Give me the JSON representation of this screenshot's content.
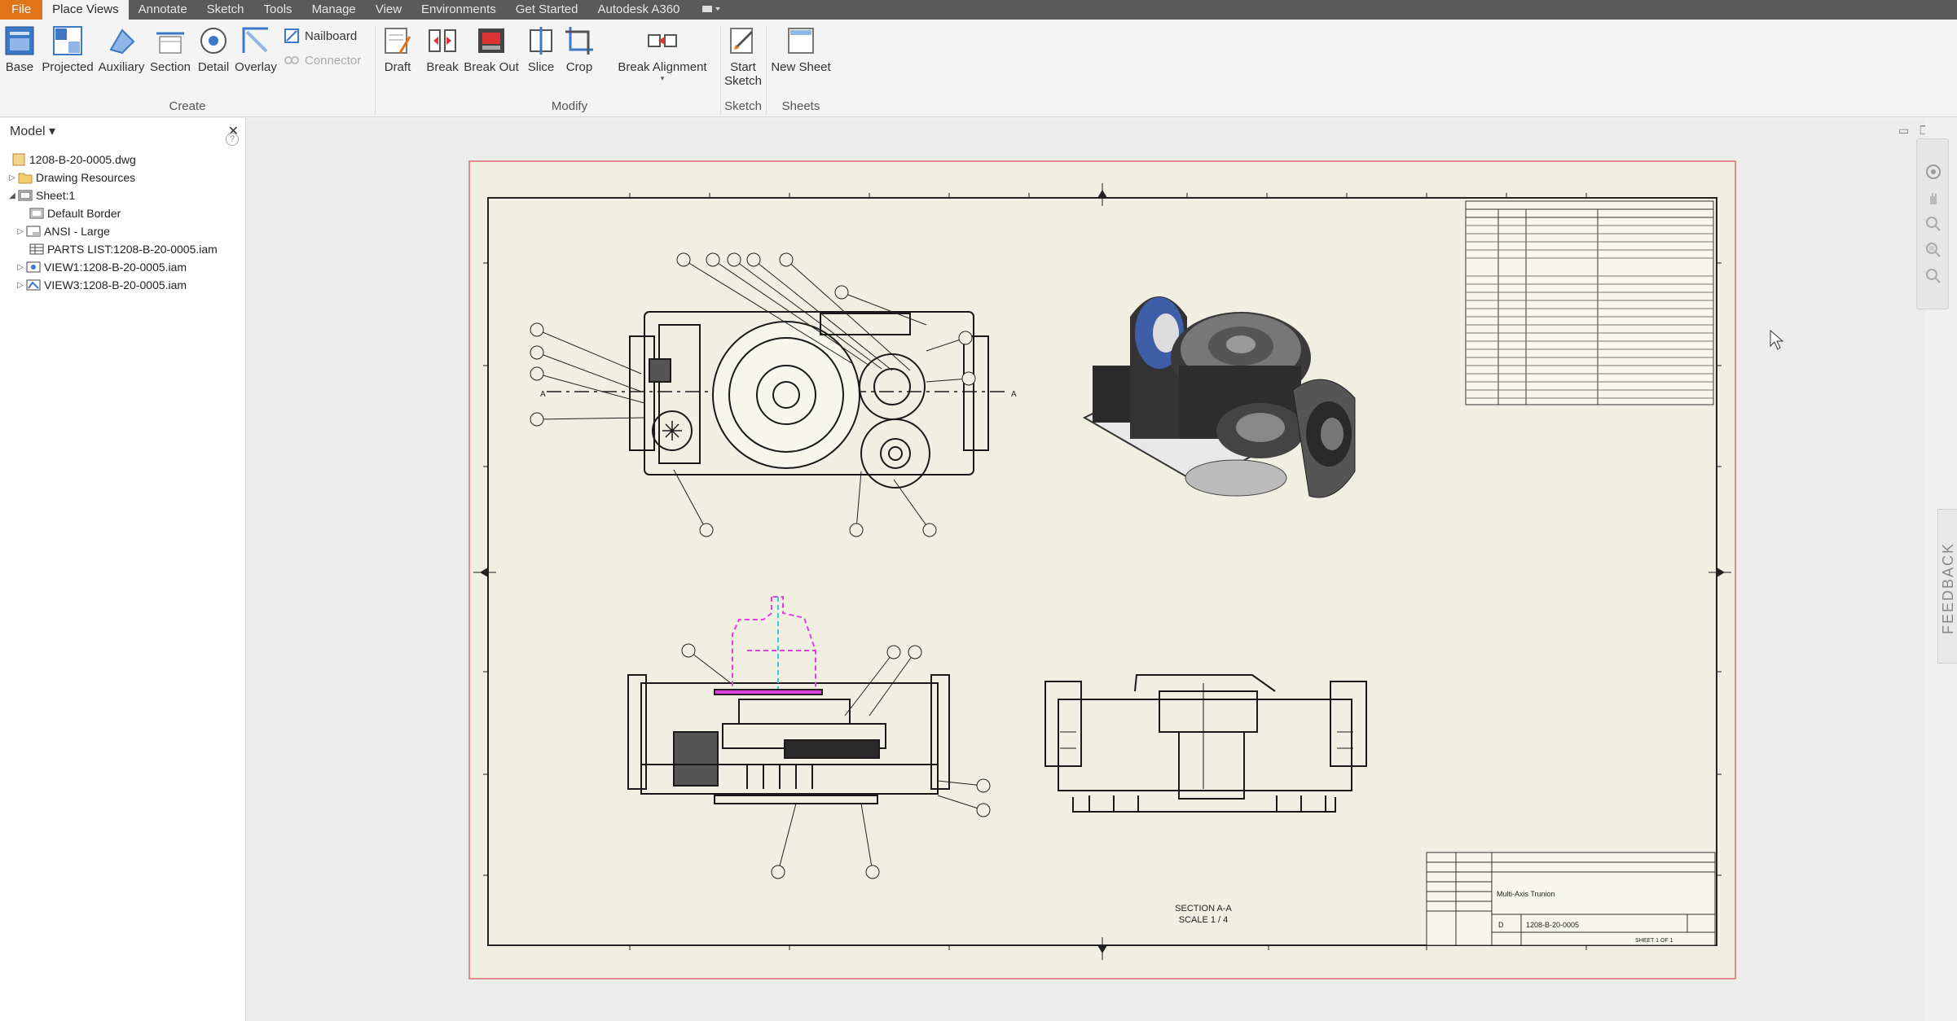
{
  "menu": {
    "file": "File",
    "tabs": [
      "Place Views",
      "Annotate",
      "Sketch",
      "Tools",
      "Manage",
      "View",
      "Environments",
      "Get Started",
      "Autodesk A360"
    ]
  },
  "ribbon": {
    "create": {
      "label": "Create",
      "buttons": [
        "Base",
        "Projected",
        "Auxiliary",
        "Section",
        "Detail",
        "Overlay"
      ],
      "nailboard": "Nailboard",
      "connector": "Connector"
    },
    "modify": {
      "label": "Modify",
      "buttons": [
        "Draft",
        "Break",
        "Break Out",
        "Slice",
        "Crop",
        "Break Alignment"
      ]
    },
    "sketch": {
      "label": "Sketch",
      "button_line1": "Start",
      "button_line2": "Sketch"
    },
    "sheets": {
      "label": "Sheets",
      "button": "New Sheet"
    }
  },
  "browser": {
    "title": "Model ▾",
    "items": [
      "1208-B-20-0005.dwg",
      "Drawing Resources",
      "Sheet:1",
      "Default Border",
      "ANSI - Large",
      "PARTS LIST:1208-B-20-0005.iam",
      "VIEW1:1208-B-20-0005.iam",
      "VIEW3:1208-B-20-0005.iam"
    ]
  },
  "drawing": {
    "section_label": "SECTION A-A",
    "scale_label": "SCALE 1 / 4",
    "title_block_title": "Multi-Axis Trunion",
    "drawing_number": "1208-B-20-0005",
    "size": "D",
    "sheet": "SHEET 1 OF 1",
    "section_marker": "A"
  },
  "feedback": "FEEDBACK",
  "colors": {
    "file_tab": "#e0741a",
    "sheet_border": "#e58a8a",
    "sheet_fill": "#f0efe2",
    "highlight_magenta": "#e040e0"
  }
}
